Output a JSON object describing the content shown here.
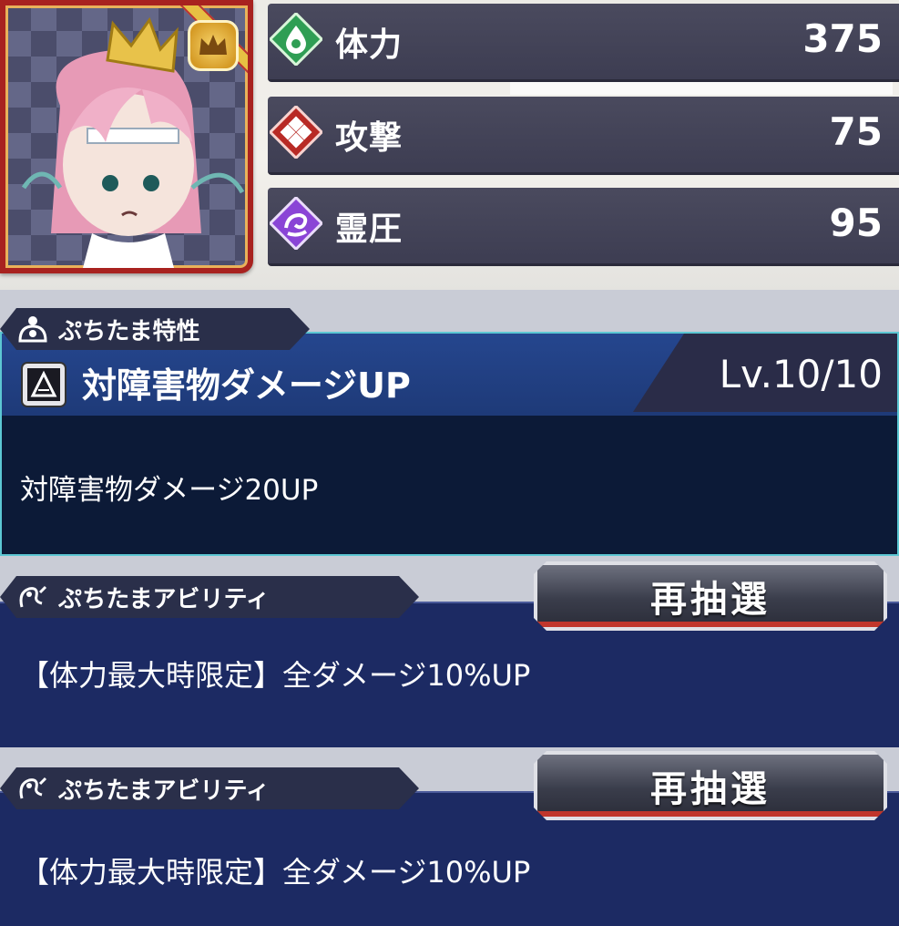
{
  "stats": [
    {
      "label": "体力",
      "value": "375",
      "icon": "hp-drop-icon",
      "color": "#2f9e54"
    },
    {
      "label": "攻撃",
      "value": "75",
      "icon": "attack-diamond-icon",
      "color": "#b82a25"
    },
    {
      "label": "霊圧",
      "value": "95",
      "icon": "spirit-pressure-icon",
      "color": "#8a44d6"
    }
  ],
  "trait": {
    "section_label": "ぷちたま特性",
    "name": "対障害物ダメージUP",
    "level": "Lv.10/10",
    "description": "対障害物ダメージ20UP"
  },
  "abilities": [
    {
      "section_label": "ぷちたまアビリティ",
      "text": "【体力最大時限定】全ダメージ10%UP",
      "button_label": "再抽選"
    },
    {
      "section_label": "ぷちたまアビリティ",
      "text": "【体力最大時限定】全ダメージ10%UP",
      "button_label": "再抽選"
    }
  ],
  "colors": {
    "accent_teal": "#5cc7d3",
    "panel_navy": "#1c2a63",
    "frame_red": "#a8221f",
    "badge_gold": "#e7c043"
  }
}
